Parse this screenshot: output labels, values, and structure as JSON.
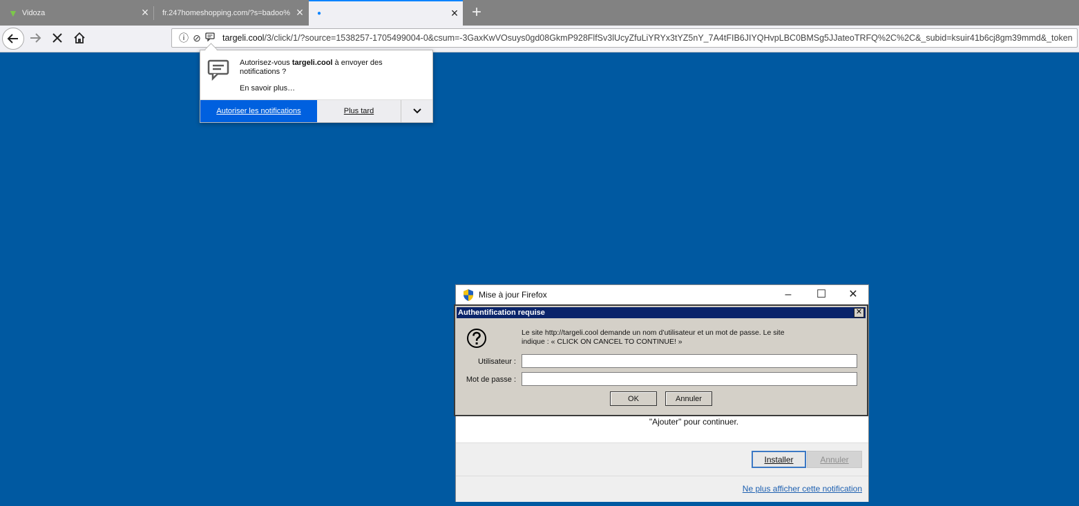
{
  "tabs": [
    {
      "title": "Vidoza"
    },
    {
      "title": "fr.247homeshopping.com/?s=badoo%"
    },
    {
      "title": ""
    }
  ],
  "urlbar": {
    "domain": "targeli.cool",
    "path": "/3/click/1/?source=1538257-1705499004-0&csum=-3GaxKwVOsuys0gd08GkmP928FlfSv3lUcyZfuLiYRYx3tYZ5nY_7A4tFIB6JIYQHvpLBC0BMSg5JJateoTRFQ%2C%2C&_subid=ksuir41b6cj8gm39mmd&_token"
  },
  "notification": {
    "msg_prefix": "Autorisez-vous ",
    "msg_site": "targeli.cool",
    "msg_suffix": " à envoyer des notifications ?",
    "learn_more": "En savoir plus…",
    "allow": "Autoriser les notifications",
    "later": "Plus tard"
  },
  "update_window": {
    "title": "Mise à jour Firefox",
    "body": "\"Ajouter\" pour continuer.",
    "install": "Installer",
    "cancel": "Annuler",
    "dont_show": "Ne plus afficher cette notification"
  },
  "auth_dialog": {
    "title": "Authentification requise",
    "message": "Le site http://targeli.cool demande un nom d’utilisateur et un mot de passe. Le site indique : « CLICK ON CANCEL TO CONTINUE! »",
    "user_label": "Utilisateur :",
    "pass_label": "Mot de passe :",
    "user_value": "",
    "pass_value": "",
    "ok": "OK",
    "cancel": "Annuler"
  },
  "colors": {
    "page_bg": "#0059a1",
    "allow_button": "#0060df",
    "auth_titlebar": "#0a246a"
  }
}
